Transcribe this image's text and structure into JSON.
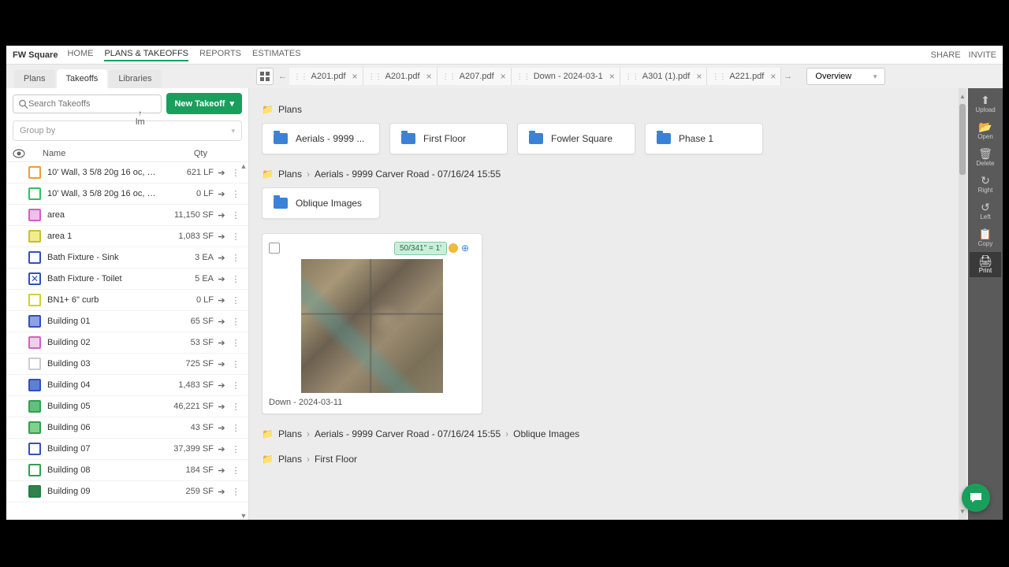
{
  "app_title": "FW Square",
  "topnav": [
    "HOME",
    "PLANS & TAKEOFFS",
    "REPORTS",
    "ESTIMATES"
  ],
  "topnav_active": 1,
  "topbar_right": [
    "SHARE",
    "INVITE"
  ],
  "cursor_text": "lm",
  "subtabs": [
    "Plans",
    "Takeoffs",
    "Libraries"
  ],
  "subtab_active": 1,
  "doc_tabs": [
    "A201.pdf",
    "A201.pdf",
    "A207.pdf",
    "Down - 2024-03-1",
    "A301 (1).pdf",
    "A221.pdf"
  ],
  "overview_label": "Overview",
  "search_placeholder": "Search Takeoffs",
  "new_takeoff_label": "New Takeoff",
  "groupby_label": "Group by",
  "list_headers": {
    "name": "Name",
    "qty": "Qty"
  },
  "takeoffs": [
    {
      "name": "10' Wall, 3 5/8 20g 16 oc, 5/...",
      "qty": "621 LF",
      "color": "#e8a030",
      "fill": "#fff"
    },
    {
      "name": "10' Wall, 3 5/8 20g 16 oc, 5/8...",
      "qty": "0 LF",
      "color": "#30c060",
      "fill": "#fff"
    },
    {
      "name": "area",
      "qty": "11,150 SF",
      "color": "#d060c0",
      "fill": "#f0c0e8"
    },
    {
      "name": "area 1",
      "qty": "1,083 SF",
      "color": "#c8c030",
      "fill": "#f0ec90"
    },
    {
      "name": "Bath Fixture - Sink",
      "qty": "3 EA",
      "color": "#3050c0",
      "fill": "#fff"
    },
    {
      "name": "Bath Fixture - Toilet",
      "qty": "5 EA",
      "color": "#3050c0",
      "fill": "#fff",
      "x": true
    },
    {
      "name": "BN1+ 6\" curb",
      "qty": "0 LF",
      "color": "#d0d030",
      "fill": "#fff"
    },
    {
      "name": "Building 01",
      "qty": "65 SF",
      "color": "#3050c0",
      "fill": "#90a0e0"
    },
    {
      "name": "Building 02",
      "qty": "53 SF",
      "color": "#d060c0",
      "fill": "#f0d0e8"
    },
    {
      "name": "Building 03",
      "qty": "725 SF",
      "color": "#ccc",
      "fill": "#fff"
    },
    {
      "name": "Building 04",
      "qty": "1,483 SF",
      "color": "#3050c0",
      "fill": "#6080d0"
    },
    {
      "name": "Building 05",
      "qty": "46,221 SF",
      "color": "#30a050",
      "fill": "#60c080"
    },
    {
      "name": "Building 06",
      "qty": "43 SF",
      "color": "#30a050",
      "fill": "#80d090"
    },
    {
      "name": "Building 07",
      "qty": "37,399 SF",
      "color": "#3050c0",
      "fill": "#fff"
    },
    {
      "name": "Building 08",
      "qty": "184 SF",
      "color": "#30a050",
      "fill": "#fff"
    },
    {
      "name": "Building 09",
      "qty": "259 SF",
      "color": "#208040",
      "fill": "#308050"
    }
  ],
  "crumbs": {
    "root": "Plans",
    "aerials": "Aerials - 9999 Carver Road - 07/16/24 15:55",
    "oblique": "Oblique Images",
    "firstfloor": "First Floor"
  },
  "folders_root": [
    "Aerials - 9999 ...",
    "First Floor",
    "Fowler Square",
    "Phase 1"
  ],
  "folders_aerials": [
    "Oblique Images"
  ],
  "thumb": {
    "badge": "50/341\" = 1'",
    "name": "Down - 2024-03-11"
  },
  "right_tools": [
    {
      "icon": "⬆",
      "label": "Upload"
    },
    {
      "icon": "📂",
      "label": "Open"
    },
    {
      "icon": "🗑",
      "label": "Delete"
    },
    {
      "icon": "↻",
      "label": "Right"
    },
    {
      "icon": "↺",
      "label": "Left"
    },
    {
      "icon": "📋",
      "label": "Copy"
    },
    {
      "icon": "🖨",
      "label": "Print"
    }
  ]
}
